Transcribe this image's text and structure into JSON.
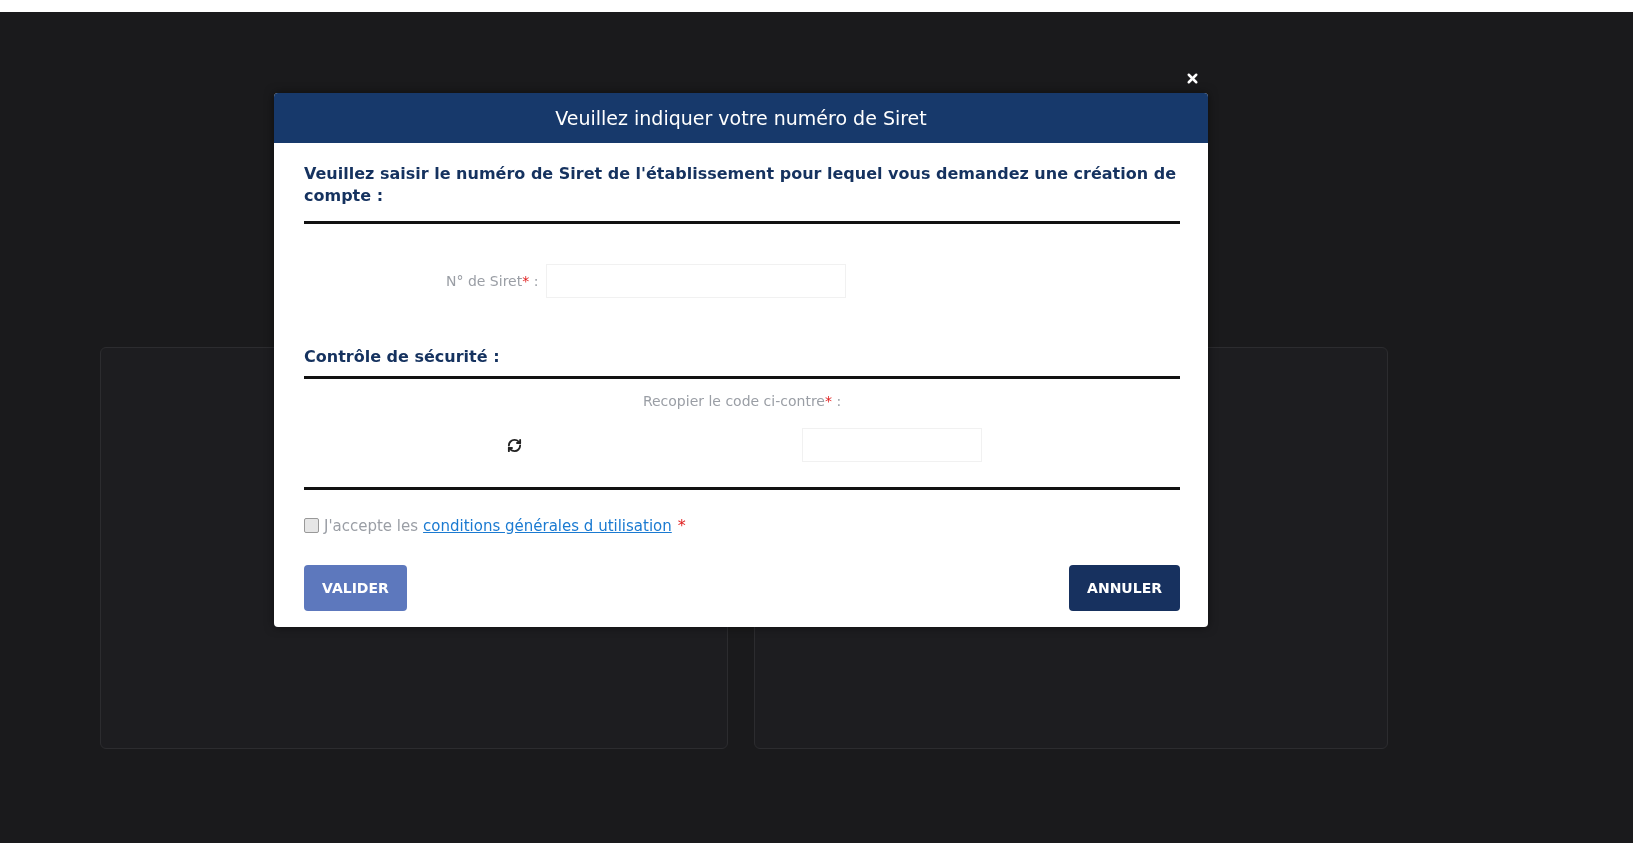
{
  "modal": {
    "title": "Veuillez indiquer votre numéro de Siret",
    "intro": "Veuillez saisir le numéro de Siret de l'établissement pour lequel vous demandez une création de compte :",
    "siret": {
      "label": "N° de Siret",
      "marker": "*",
      "suffix": ":"
    },
    "security_heading": "Contrôle de sécurité :",
    "captcha": {
      "label": "Recopier le code ci-contre",
      "marker": "*",
      "suffix": ":"
    },
    "terms": {
      "checked": false,
      "text": "J'accepte les",
      "link": "conditions générales d utilisation",
      "marker": "*"
    },
    "buttons": [
      {
        "label": "VALIDER",
        "disabled": true
      },
      {
        "label": "ANNULER",
        "disabled": false
      }
    ]
  }
}
